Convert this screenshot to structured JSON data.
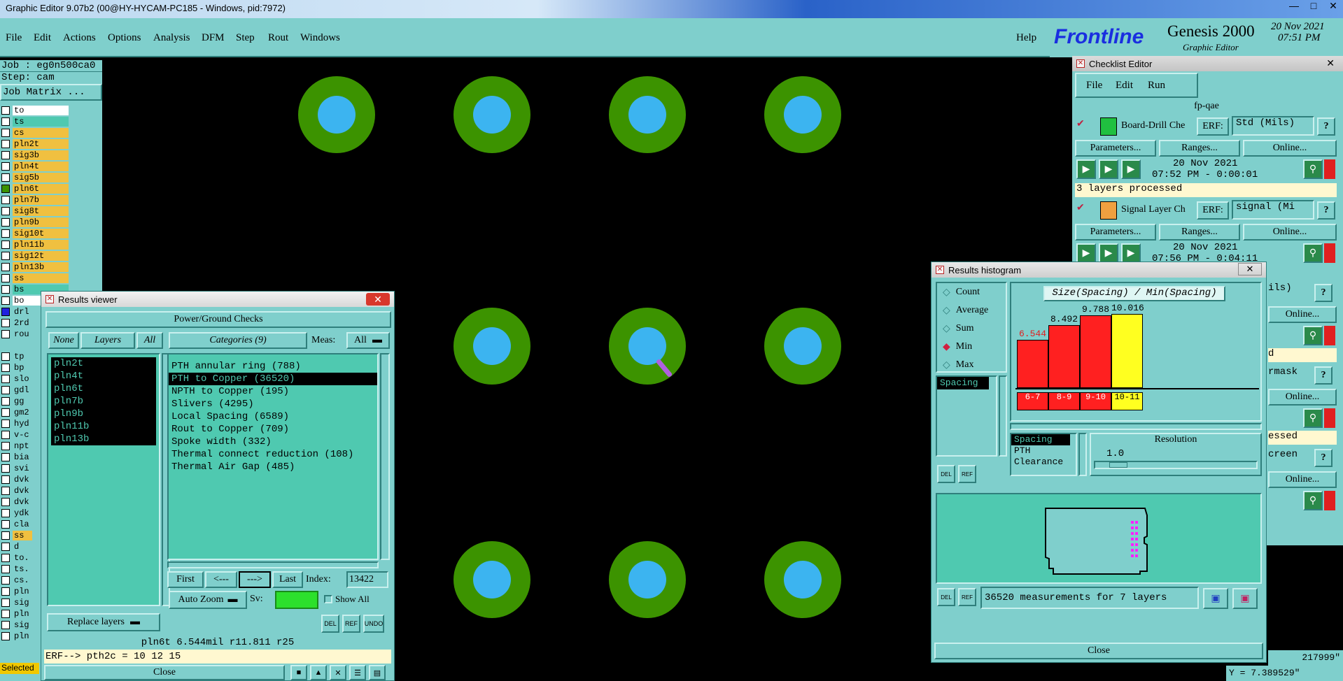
{
  "window": {
    "title": "Graphic Editor 9.07b2 (00@HY-HYCAM-PC185 - Windows, pid:7972)"
  },
  "menu": [
    "File",
    "Edit",
    "Actions",
    "Options",
    "Analysis",
    "DFM",
    "Step",
    "Rout",
    "Windows"
  ],
  "help": "Help",
  "logo": {
    "brand": "Frontline",
    "product": "Genesis 2000",
    "sub": "Graphic Editor",
    "date": "20 Nov 2021",
    "time": "07:51 PM"
  },
  "left": {
    "job": "Job : eg0n500ca0",
    "step": "Step: cam",
    "matrix_button": "Job Matrix ...",
    "layers": [
      "to",
      "ts",
      "cs",
      "pln2t",
      "sig3b",
      "pln4t",
      "sig5b",
      "pln6t",
      "pln7b",
      "sig8t",
      "pln9b",
      "sig10t",
      "pln11b",
      "sig12t",
      "pln13b",
      "ss",
      "bs",
      "bo",
      "drl",
      "2rd",
      "rou",
      "",
      "tp",
      "bp",
      "slo",
      "gdl",
      "gg",
      "gm2",
      "hyd",
      "v-c",
      "npt",
      "bia",
      "svi",
      "dvk",
      "dvk",
      "dvk",
      "ydk",
      "cla",
      "ss",
      "d",
      "to.",
      "ts.",
      "cs.",
      "pln",
      "sig",
      "pln",
      "sig",
      "pln"
    ],
    "selected_label": "Selected"
  },
  "results_viewer": {
    "title": "Results viewer",
    "header": "Power/Ground Checks",
    "btn_none": "None",
    "btn_layers": "Layers",
    "btn_all": "All",
    "categories_label": "Categories (9)",
    "meas_label": "Meas:",
    "meas_value": "All",
    "layers": [
      "pln2t",
      "pln4t",
      "pln6t",
      "pln7b",
      "pln9b",
      "pln11b",
      "pln13b"
    ],
    "categories": [
      "PTH annular ring (788)",
      "PTH to Copper (36520)",
      "NPTH to Copper (195)",
      "Slivers (4295)",
      "Local Spacing (6589)",
      "Rout to Copper (709)",
      "Spoke width (332)",
      "Thermal connect reduction (108)",
      "Thermal Air Gap (485)"
    ],
    "nav": {
      "first": "First",
      "prev": "<---",
      "next": "--->",
      "last": "Last",
      "index_label": "Index:",
      "index_value": "13422"
    },
    "auto_zoom": "Auto Zoom",
    "sv_label": "Sv:",
    "show_all": "Show All",
    "replace_layers": "Replace layers",
    "status": "pln6t 6.544mil  r11.811  r25",
    "erf": "ERF--> pth2c = 10 12 15",
    "close": "Close",
    "icons": [
      "DEL",
      "REF",
      "UNDO"
    ]
  },
  "checklist": {
    "title": "Checklist Editor",
    "menu": [
      "File",
      "Edit",
      "Run"
    ],
    "name": "fp-qae",
    "erf_label": "ERF:",
    "params": "Parameters...",
    "ranges": "Ranges...",
    "online": "Online...",
    "items": [
      {
        "name": "Board-Drill Che",
        "erf": "Std (Mils)",
        "date": "20 Nov 2021",
        "time": "07:52 PM - 0:00:01",
        "msg": "3 layers processed"
      },
      {
        "name": "Signal Layer Ch",
        "erf": "signal (Mi",
        "date": "20 Nov 2021",
        "time": "07:56 PM - 0:04:11",
        "msg": ""
      }
    ],
    "partial": [
      "ils)",
      "Online...",
      "d",
      "rmask",
      "Online...",
      "essed",
      "creen",
      "Online..."
    ]
  },
  "histogram": {
    "title": "Results histogram",
    "options": [
      "Count",
      "Average",
      "Sum",
      "Min",
      "Max"
    ],
    "selected_option": "Min",
    "list": [
      "Spacing"
    ],
    "chart_title": "Size(Spacing) / Min(Spacing)",
    "chart_data": {
      "type": "bar",
      "categories": [
        "6-7",
        "8-9",
        "9-10",
        "10-11"
      ],
      "values": [
        6.544,
        8.492,
        9.788,
        10.016
      ],
      "value_labels": [
        "6.544",
        "8.492",
        "9.788",
        "10.016"
      ],
      "colors": [
        "#ff2020",
        "#ff2020",
        "#ff2020",
        "#ffff20"
      ],
      "title": "Size(Spacing) / Min(Spacing)",
      "ylim": [
        0,
        10.016
      ]
    },
    "measure_list": [
      "Spacing",
      "PTH",
      "Clearance"
    ],
    "resolution_label": "Resolution",
    "resolution_value": "1.0",
    "summary": "36520 measurements for 7 layers",
    "close": "Close"
  },
  "coords": {
    "x": "217999\"",
    "y": "Y = 7.389529\""
  }
}
